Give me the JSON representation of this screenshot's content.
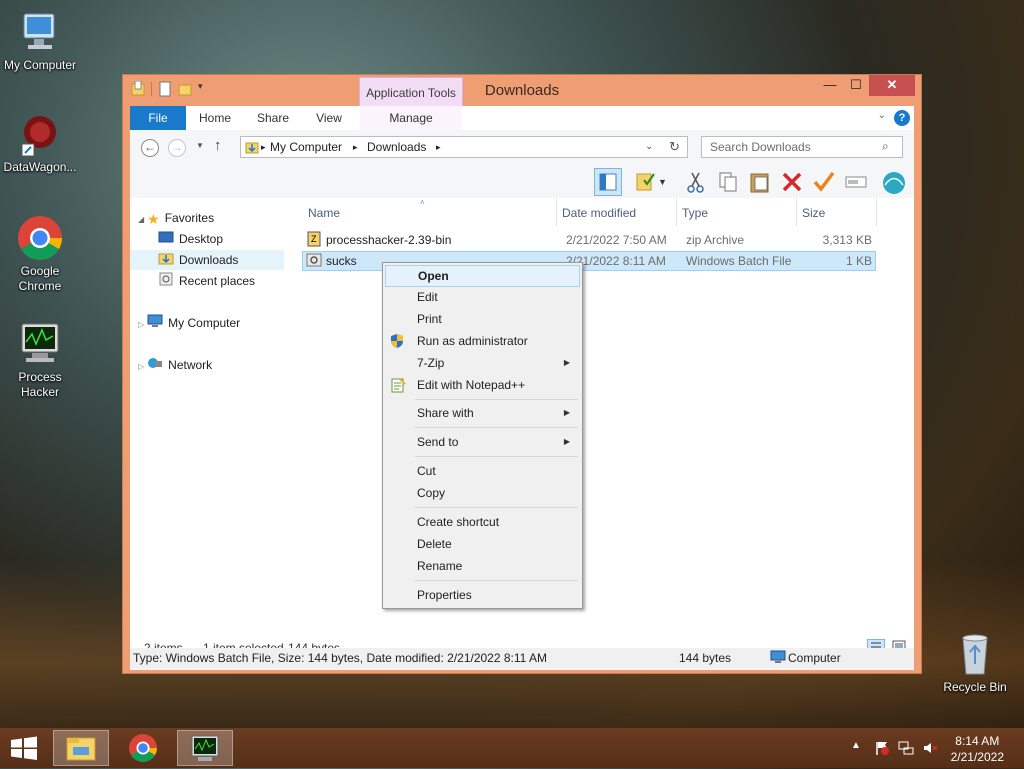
{
  "desktop": {
    "icons": [
      {
        "label": "My Computer"
      },
      {
        "label": "DataWagon..."
      },
      {
        "label": "Google Chrome"
      },
      {
        "label": "Process Hacker"
      },
      {
        "label": "Recycle Bin"
      }
    ]
  },
  "window": {
    "title": "Downloads",
    "contextual_tab_group": "Application Tools",
    "buttons": {
      "minimize": "—",
      "maximize": "☐",
      "close": "✕"
    },
    "ribbon_tabs": [
      "File",
      "Home",
      "Share",
      "View",
      "Manage"
    ],
    "address": {
      "crumbs": [
        "My Computer",
        "Downloads"
      ]
    },
    "search": {
      "placeholder": "Search Downloads"
    }
  },
  "nav_pane": {
    "favorites_label": "Favorites",
    "favorites": [
      "Desktop",
      "Downloads",
      "Recent places"
    ],
    "my_computer": "My Computer",
    "network": "Network"
  },
  "file_list": {
    "columns": [
      "Name",
      "Date modified",
      "Type",
      "Size"
    ],
    "rows": [
      {
        "name": "processhacker-2.39-bin",
        "date": "2/21/2022 7:50 AM",
        "type": "zip Archive",
        "size": "3,313 KB"
      },
      {
        "name": "sucks",
        "date": "2/21/2022 8:11 AM",
        "type": "Windows Batch File",
        "size": "1 KB"
      }
    ]
  },
  "status": {
    "item_count": "2 items",
    "selected": "1 item selected",
    "selected_size": "144 bytes",
    "details": "Type: Windows Batch File, Size: 144 bytes, Date modified: 2/21/2022 8:11 AM",
    "size": "144 bytes",
    "location": "Computer"
  },
  "context_menu": {
    "open": "Open",
    "edit": "Edit",
    "print": "Print",
    "run_as_admin": "Run as administrator",
    "seven_zip": "7-Zip",
    "edit_notepad": "Edit with Notepad++",
    "share_with": "Share with",
    "send_to": "Send to",
    "cut": "Cut",
    "copy": "Copy",
    "create_shortcut": "Create shortcut",
    "delete": "Delete",
    "rename": "Rename",
    "properties": "Properties"
  },
  "taskbar": {
    "time": "8:14 AM",
    "date": "2/21/2022"
  },
  "colors": {
    "window_frame": "#ee9e72",
    "file_tab": "#1979ca",
    "selection": "#cde8f8",
    "taskbar": "#6b3c20"
  }
}
